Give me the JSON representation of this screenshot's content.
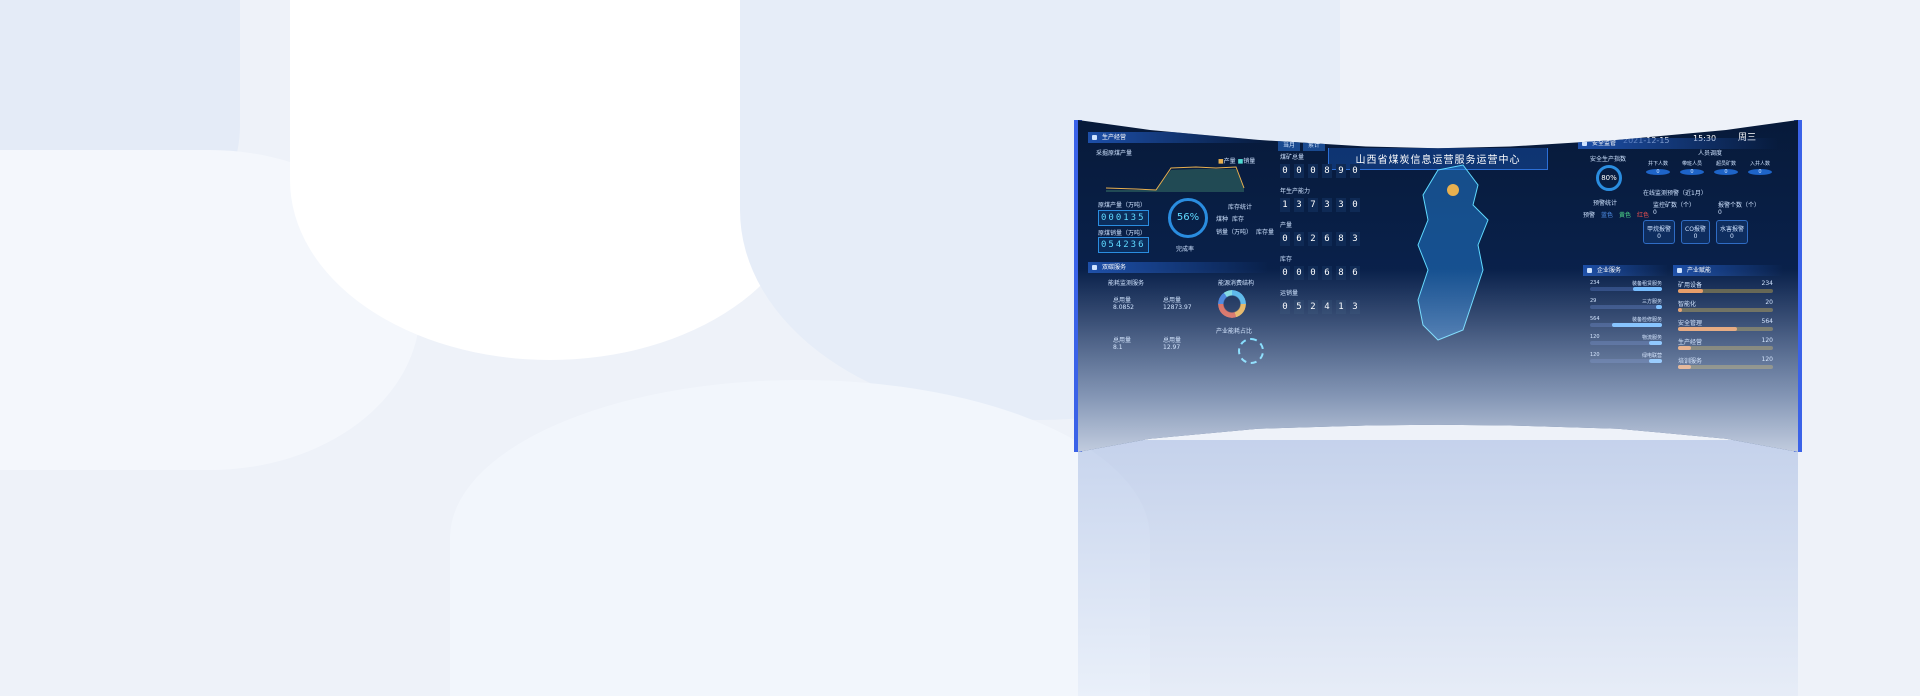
{
  "header": {
    "title": "山西省煤炭信息运营服务运营中心",
    "date": "2021-12-15",
    "time": "15:30",
    "weekday": "周三"
  },
  "production": {
    "title": "生产经营",
    "chart_title": "采掘原煤产量",
    "legend": [
      "产量",
      "销量"
    ],
    "counter1_label": "原煤产量（万吨）",
    "counter1": "000135",
    "counter2_label": "原煤销量（万吨）",
    "counter2": "054236",
    "gauge_value": "56%",
    "gauge_label": "完成率",
    "stats_title": "库存统计",
    "stats_cols": [
      "煤种",
      "库存",
      "销量（万吨）",
      "库存量"
    ]
  },
  "data_service": {
    "title": "双碳服务",
    "sub1": "能耗监测服务",
    "sub2": "能源消费结构",
    "sub3": "产业能耗占比",
    "items": [
      {
        "label": "总用量",
        "value": "8.0852"
      },
      {
        "label": "总用量",
        "value": "12873.97"
      },
      {
        "label": "总用量",
        "value": "8.1"
      },
      {
        "label": "总用量",
        "value": "12.97"
      }
    ],
    "donut_colors": [
      "#4fb3e8",
      "#e8b04f",
      "#d9604f",
      "#3a7ad9",
      "#7ad9e0"
    ]
  },
  "center": {
    "tabs": [
      "当月",
      "累计"
    ],
    "counters": [
      {
        "label": "煤矿总量",
        "digits": "000890"
      },
      {
        "label": "年生产能力",
        "digits": "137330"
      },
      {
        "label": "产量",
        "digits": "062683"
      },
      {
        "label": "库存",
        "digits": "000686"
      },
      {
        "label": "运销量",
        "digits": "052413"
      }
    ]
  },
  "safety": {
    "title": "安全监管",
    "gauge_title": "安全生产指数",
    "gauge_value": "80%",
    "alarm_title": "预警统计",
    "alarm_levels": [
      "预警",
      "蓝色",
      "黄色",
      "红色"
    ],
    "personnel_title": "人员调度",
    "personnel": [
      {
        "label": "井下人数",
        "value": "0"
      },
      {
        "label": "带班人员",
        "value": "0"
      },
      {
        "label": "超员矿数",
        "value": "0"
      },
      {
        "label": "入井人数",
        "value": "0"
      }
    ],
    "monitor_title": "在线监测预警（近1月）",
    "monitor": [
      {
        "label": "监控矿数（个）",
        "value": "0"
      },
      {
        "label": "报警个数（个）",
        "value": "0"
      }
    ],
    "boxes": [
      {
        "label": "甲烷报警",
        "value": "0"
      },
      {
        "label": "CO报警",
        "value": "0"
      },
      {
        "label": "水害报警",
        "value": "0"
      }
    ]
  },
  "enterprise": {
    "title": "企业服务",
    "items": [
      {
        "label": "装备租赁服务",
        "value": "234",
        "pct": 40
      },
      {
        "label": "三方服务",
        "value": "29",
        "pct": 8
      },
      {
        "label": "装备检修服务",
        "value": "564",
        "pct": 70
      },
      {
        "label": "物流服务",
        "value": "120",
        "pct": 18
      },
      {
        "label": "绿电联营",
        "value": "120",
        "pct": 18
      }
    ]
  },
  "industry": {
    "title": "产业赋能",
    "items": [
      {
        "label": "矿用设备",
        "value": "234",
        "pct": 26
      },
      {
        "label": "智能化",
        "value": "20",
        "pct": 4
      },
      {
        "label": "安全管理",
        "value": "564",
        "pct": 62
      },
      {
        "label": "生产经营",
        "value": "120",
        "pct": 14
      },
      {
        "label": "培训服务",
        "value": "120",
        "pct": 14
      }
    ]
  }
}
